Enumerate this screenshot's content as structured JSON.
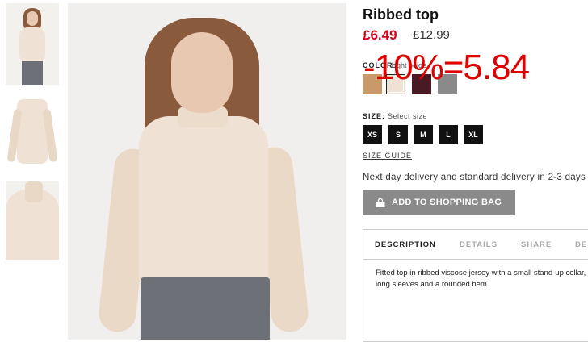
{
  "product": {
    "title": "Ribbed top",
    "price": "£6.49",
    "old_price": "£12.99",
    "overlay_text": "-10%=5.84"
  },
  "color": {
    "label": "COLOR:",
    "selected": "Light beige",
    "swatches": [
      {
        "name": "camel",
        "hex": "#c9996a"
      },
      {
        "name": "light-beige",
        "hex": "#efe2d4"
      },
      {
        "name": "burgundy",
        "hex": "#4a1a24"
      },
      {
        "name": "grey",
        "hex": "#8a8a8a"
      }
    ]
  },
  "size": {
    "label": "SIZE:",
    "placeholder": "Select size",
    "options": [
      "XS",
      "S",
      "M",
      "L",
      "XL"
    ],
    "guide_label": "SIZE GUIDE"
  },
  "delivery_text": "Next day delivery and standard delivery in 2-3 days",
  "bag_button_label": "ADD TO SHOPPING BAG",
  "tabs": [
    "DESCRIPTION",
    "DETAILS",
    "SHARE",
    "DE"
  ],
  "description": "Fitted top in ribbed viscose jersey with a small stand-up collar, long sleeves and a rounded hem.",
  "colors": {
    "price_red": "#d6001c",
    "button_grey": "#8a8a8a"
  }
}
